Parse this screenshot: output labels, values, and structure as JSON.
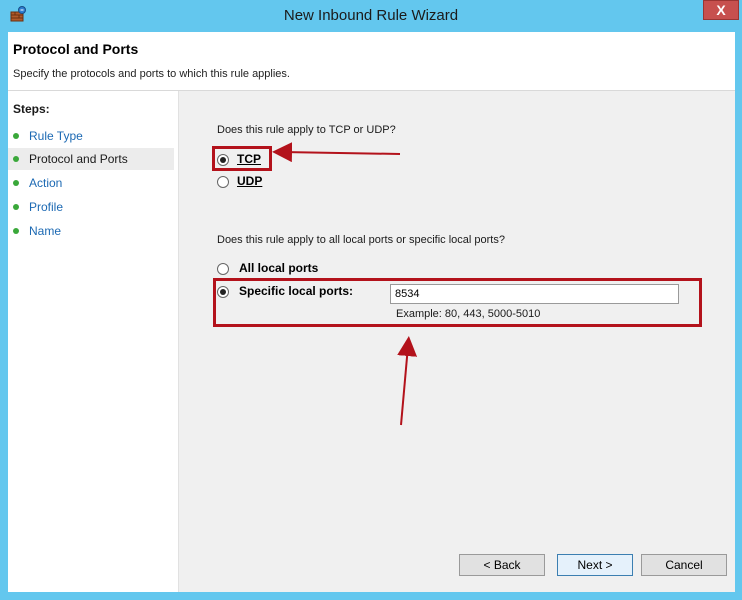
{
  "window": {
    "title": "New Inbound Rule Wizard",
    "close_label": "X",
    "icon": "firewall-wizard-icon"
  },
  "header": {
    "title": "Protocol and Ports",
    "subtitle": "Specify the protocols and ports to which this rule applies."
  },
  "steps": {
    "title": "Steps:",
    "items": [
      {
        "label": "Rule Type",
        "active": false
      },
      {
        "label": "Protocol and Ports",
        "active": true
      },
      {
        "label": "Action",
        "active": false
      },
      {
        "label": "Profile",
        "active": false
      },
      {
        "label": "Name",
        "active": false
      }
    ]
  },
  "protocol": {
    "question": "Does this rule apply to TCP or UDP?",
    "tcp_label": "TCP",
    "udp_label": "UDP",
    "selected": "TCP"
  },
  "ports": {
    "question": "Does this rule apply to all local ports or specific local ports?",
    "all_label": "All local ports",
    "specific_label": "Specific local ports:",
    "selected": "specific",
    "value": "8534",
    "example": "Example: 80, 443, 5000-5010"
  },
  "buttons": {
    "back": "< Back",
    "next": "Next >",
    "cancel": "Cancel"
  },
  "annotation": {
    "color": "#b3121b"
  }
}
